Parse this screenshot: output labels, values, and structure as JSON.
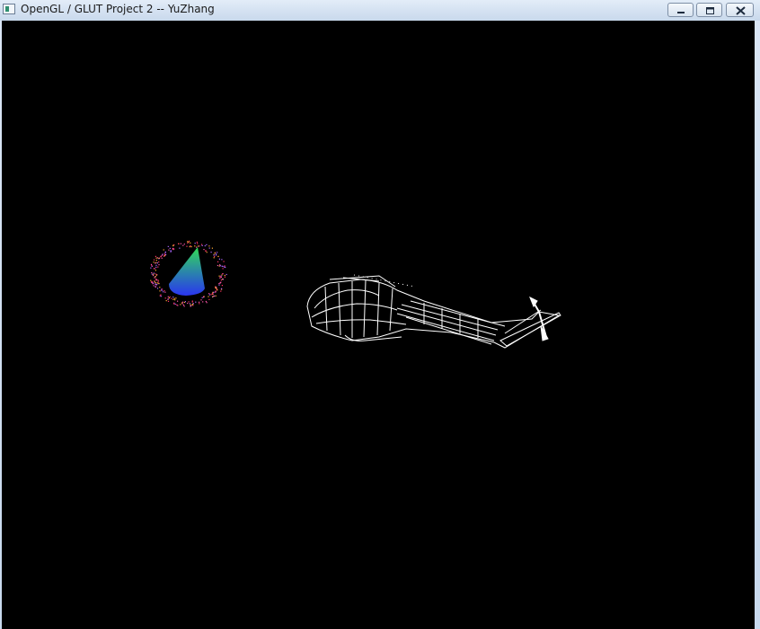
{
  "window": {
    "title": "OpenGL / GLUT Project 2 -- YuZhang",
    "controls": [
      "minimize-icon",
      "maximize-icon",
      "close-icon"
    ]
  },
  "scene": {
    "background": "#000000",
    "wireframe_color": "#ffffff",
    "cone_colors": [
      "#22cc44",
      "#2233ee"
    ],
    "particle_colors": [
      "#ff55aa",
      "#ffaa33",
      "#aa66ff",
      "#ff3366"
    ]
  }
}
